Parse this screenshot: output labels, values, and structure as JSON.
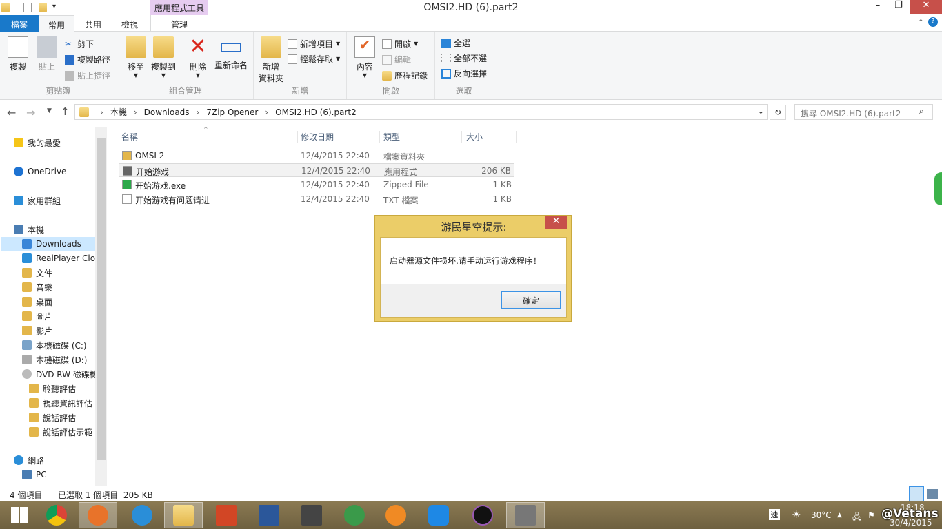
{
  "window": {
    "title": "OMSI2.HD (6).part2",
    "context_tab": "應用程式工具"
  },
  "tabs": {
    "file": "檔案",
    "home": "常用",
    "share": "共用",
    "view": "檢視",
    "manage": "管理"
  },
  "ribbon": {
    "clipboard": {
      "label": "剪貼簿",
      "copy": "複製",
      "paste": "貼上",
      "cut": "剪下",
      "copy_path": "複製路徑",
      "paste_shortcut": "貼上捷徑"
    },
    "organize": {
      "label": "組合管理",
      "move_to": "移至",
      "copy_to": "複製到",
      "delete": "刪除",
      "rename": "重新命名"
    },
    "new": {
      "label": "新增",
      "new_folder": "新增\n資料夾",
      "new_item": "新增項目",
      "easy_access": "輕鬆存取"
    },
    "open": {
      "label": "開啟",
      "properties": "內容",
      "open": "開啟",
      "edit": "編輯",
      "history": "歷程記錄"
    },
    "select": {
      "label": "選取",
      "select_all": "全選",
      "select_none": "全部不選",
      "invert": "反向選擇"
    }
  },
  "address": {
    "crumbs": [
      "本機",
      "Downloads",
      "7Zip Opener",
      "OMSI2.HD (6).part2"
    ],
    "search_placeholder": "搜尋 OMSI2.HD (6).part2"
  },
  "nav": {
    "items": [
      "我的最愛",
      "OneDrive",
      "家用群組",
      "本機",
      "Downloads",
      "RealPlayer Cloud",
      "文件",
      "音樂",
      "桌面",
      "圖片",
      "影片",
      "本機磁碟 (C:)",
      "本機磁碟 (D:)",
      "DVD RW 磁碟機",
      "聆聽評估",
      "視聽資訊評估",
      "說話評估",
      "說話評估示範",
      "網路",
      "PC"
    ]
  },
  "columns": {
    "name": "名稱",
    "date": "修改日期",
    "type": "類型",
    "size": "大小"
  },
  "files": [
    {
      "name": "OMSI 2",
      "date": "12/4/2015 22:40",
      "type": "檔案資料夾",
      "size": ""
    },
    {
      "name": "开始游戏",
      "date": "12/4/2015 22:40",
      "type": "應用程式",
      "size": "206 KB"
    },
    {
      "name": "开始游戏.exe",
      "date": "12/4/2015 22:40",
      "type": "Zipped File",
      "size": "1 KB"
    },
    {
      "name": "开始游戏有问题请进",
      "date": "12/4/2015 22:40",
      "type": "TXT 檔案",
      "size": "1 KB"
    }
  ],
  "status": {
    "count": "4 個項目",
    "selected": "已選取 1 個項目  205 KB"
  },
  "dialog": {
    "title": "游民星空提示:",
    "message": "启动器源文件损坏,请手动运行游戏程序！",
    "ok": "確定",
    "close": "✕"
  },
  "taskbar": {
    "ime": "速",
    "temperature": "30°C",
    "time": "18:18",
    "date": "30/4/2015",
    "watermark": "@Vetans"
  }
}
